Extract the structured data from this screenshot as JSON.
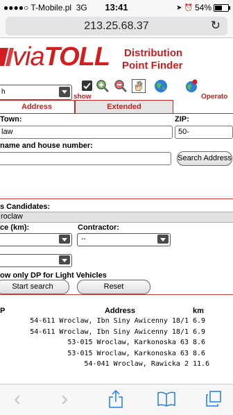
{
  "status_bar": {
    "signal": "●●●●○",
    "carrier": "T-Mobile.pl",
    "network": "3G",
    "time": "13:41",
    "battery": "54%",
    "battery_level": 0.54
  },
  "browser": {
    "url": "213.25.68.37",
    "reload_glyph": "↻"
  },
  "header": {
    "logo_via": "via",
    "logo_toll": "TOLL",
    "title_line1": "Distribution",
    "title_line2": "Point Finder"
  },
  "toolbar": {
    "mode_value": "h",
    "show_label": "show",
    "operator_label": "Operato"
  },
  "tabs": {
    "address": "Address",
    "extended": "Extended"
  },
  "form": {
    "town_label": "Town:",
    "town_value": "law",
    "zip_label": "ZIP:",
    "zip_value": "50-",
    "street_label": "name and house number:",
    "street_value": "",
    "search_address_label": "Search Address"
  },
  "candidates": {
    "label": "s Candidates:",
    "value": "roclaw"
  },
  "filters": {
    "distance_label": "ce (km):",
    "distance_value": "",
    "contractor_label": "Contractor:",
    "contractor_value": "--",
    "third_value": "",
    "light_vehicles_label": "ow only DP for Light Vehicles",
    "start_search_label": "Start search",
    "reset_label": "Reset"
  },
  "results": {
    "col_dp": "P",
    "col_address": "Address",
    "col_km": "km",
    "rows": [
      {
        "address": "54-611 Wroclaw, Ibn Siny Awicenny 18/1",
        "km": "6.9"
      },
      {
        "address": "54-611 Wroclaw, Ibn Siny Awicenny 18/1",
        "km": "6.9"
      },
      {
        "address": "53-015 Wroclaw, Karkonoska 63",
        "km": "8.6"
      },
      {
        "address": "53-015 Wroclaw, Karkonoska 63",
        "km": "8.6"
      },
      {
        "address": "54-041 Wroclaw, Rawicka 2",
        "km": "11.6"
      }
    ]
  },
  "bottom_bar": {
    "back_glyph": "‹",
    "forward_glyph": "›",
    "share_glyph": "⇧",
    "bookmarks_glyph": "📖",
    "tabs_glyph": "❐"
  },
  "colors": {
    "brand_red": "#c81f1f",
    "ios_blue": "#1a7cf7"
  }
}
